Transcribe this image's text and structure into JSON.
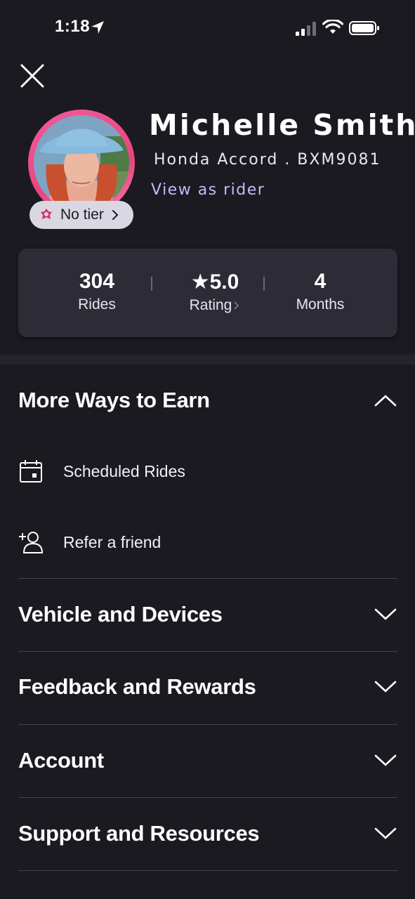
{
  "status": {
    "time": "1:18"
  },
  "profile": {
    "name": "Michelle Smith",
    "vehicle": "Honda Accord . BXM9081",
    "view_as_rider": "View as rider",
    "tier": "No tier"
  },
  "stats": [
    {
      "value": "304",
      "label": "Rides"
    },
    {
      "value": "★5.0",
      "label": "Rating"
    },
    {
      "value": "4",
      "label": "Months"
    }
  ],
  "sections": {
    "more_ways": {
      "title": "More Ways to Earn",
      "items": [
        {
          "label": "Scheduled Rides",
          "icon": "calendar-icon"
        },
        {
          "label": "Refer a friend",
          "icon": "add-person-icon"
        }
      ]
    },
    "vehicle": {
      "title": "Vehicle and Devices"
    },
    "feedback": {
      "title": "Feedback and Rewards"
    },
    "account": {
      "title": "Account"
    },
    "support": {
      "title": "Support and Resources"
    }
  },
  "colors": {
    "background": "#1b1a21",
    "card": "#2d2c36",
    "accent_link": "#c9b7ff",
    "avatar_ring": "#e8457f"
  }
}
